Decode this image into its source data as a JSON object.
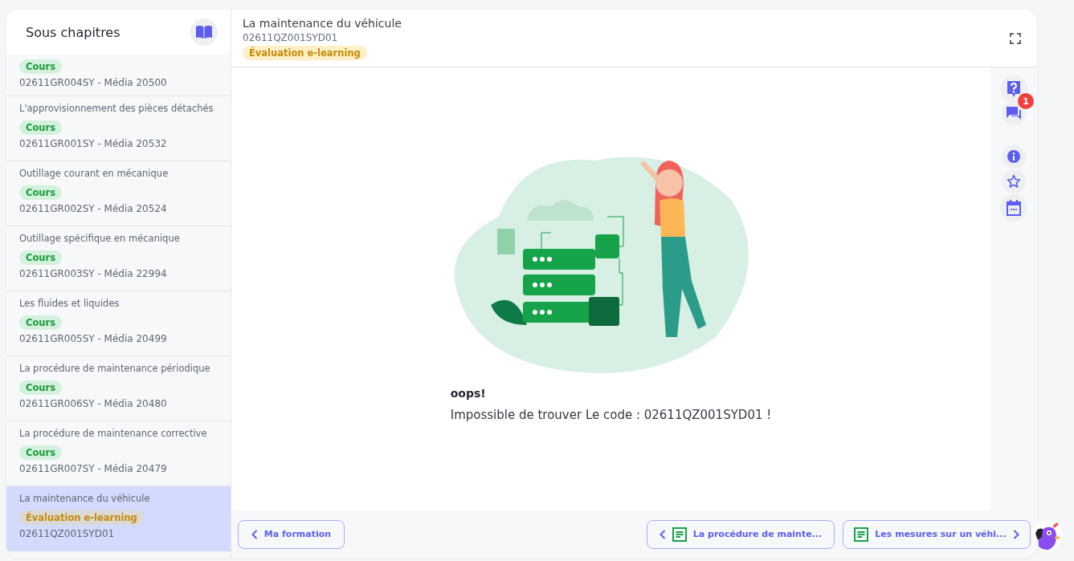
{
  "sidebar": {
    "title": "Sous chapitres",
    "items": [
      {
        "badge": {
          "label": "Cours",
          "kind": "cours"
        },
        "code": "02611GR004SY - Média 20500",
        "selected": false
      },
      {
        "title": "L'approvisionnement des pièces détachés",
        "badge": {
          "label": "Cours",
          "kind": "cours"
        },
        "code": "02611GR001SY - Média 20532",
        "selected": false
      },
      {
        "title": "Outillage courant en mécanique",
        "badge": {
          "label": "Cours",
          "kind": "cours"
        },
        "code": "02611GR002SY - Média 20524",
        "selected": false
      },
      {
        "title": "Outillage spécifique en mécanique",
        "badge": {
          "label": "Cours",
          "kind": "cours"
        },
        "code": "02611GR003SY - Média 22994",
        "selected": false
      },
      {
        "title": "Les fluides et liquides",
        "badge": {
          "label": "Cours",
          "kind": "cours"
        },
        "code": "02611GR005SY - Média 20499",
        "selected": false
      },
      {
        "title": "La procédure de maintenance périodique",
        "badge": {
          "label": "Cours",
          "kind": "cours"
        },
        "code": "02611GR006SY - Média 20480",
        "selected": false
      },
      {
        "title": "La procédure de maintenance corrective",
        "badge": {
          "label": "Cours",
          "kind": "cours"
        },
        "code": "02611GR007SY - Média 20479",
        "selected": false
      },
      {
        "title": "La maintenance du véhicule",
        "badge": {
          "label": "Évaluation e-learning",
          "kind": "evaluation"
        },
        "code": "02611QZ001SYD01",
        "selected": true
      }
    ]
  },
  "header": {
    "title": "La maintenance du véhicule",
    "code": "02611QZ001SYD01",
    "badge": {
      "label": "Évaluation e-learning",
      "kind": "evaluation"
    }
  },
  "error": {
    "title": "oops!",
    "message": "Impossible de trouver Le code : 02611QZ001SYD01 !"
  },
  "rail": {
    "chat_count": "1"
  },
  "footer": {
    "back": "Ma formation",
    "previous": "La procédure de mainte...",
    "next": "Les mesures sur un véhi..."
  }
}
